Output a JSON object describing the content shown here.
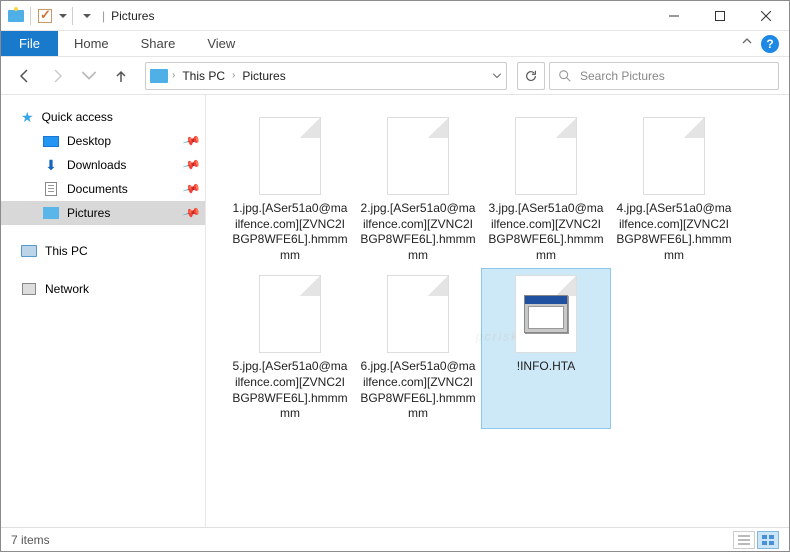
{
  "title": "Pictures",
  "menu": {
    "file": "File",
    "home": "Home",
    "share": "Share",
    "view": "View"
  },
  "breadcrumb": {
    "root": "This PC",
    "folder": "Pictures"
  },
  "search": {
    "placeholder": "Search Pictures"
  },
  "sidebar": {
    "quick": "Quick access",
    "desktop": "Desktop",
    "downloads": "Downloads",
    "documents": "Documents",
    "pictures": "Pictures",
    "thispc": "This PC",
    "network": "Network"
  },
  "files": [
    {
      "name": "1.jpg.[ASer51a0@mailfence.com][ZVNC2IBGP8WFE6L].hmmmmm",
      "type": "file"
    },
    {
      "name": "2.jpg.[ASer51a0@mailfence.com][ZVNC2IBGP8WFE6L].hmmmmm",
      "type": "file"
    },
    {
      "name": "3.jpg.[ASer51a0@mailfence.com][ZVNC2IBGP8WFE6L].hmmmmm",
      "type": "file"
    },
    {
      "name": "4.jpg.[ASer51a0@mailfence.com][ZVNC2IBGP8WFE6L].hmmmmm",
      "type": "file"
    },
    {
      "name": "5.jpg.[ASer51a0@mailfence.com][ZVNC2IBGP8WFE6L].hmmmmm",
      "type": "file"
    },
    {
      "name": "6.jpg.[ASer51a0@mailfence.com][ZVNC2IBGP8WFE6L].hmmmmm",
      "type": "file"
    },
    {
      "name": "!INFO.HTA",
      "type": "hta",
      "selected": true
    }
  ],
  "status": {
    "count": "7 items"
  },
  "watermark": {
    "a": "pc",
    "b": "risk",
    ".c": ".com"
  }
}
